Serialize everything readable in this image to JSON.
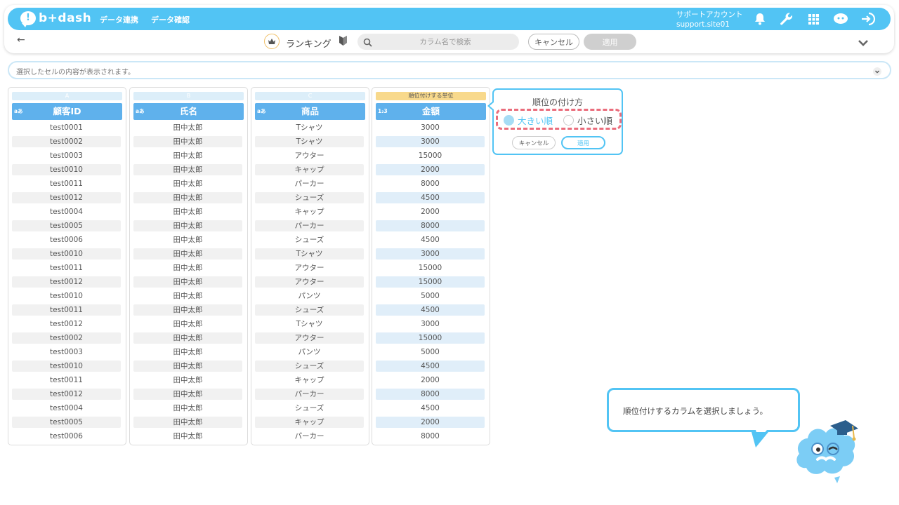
{
  "header": {
    "logo_text": "b+dash",
    "logo_mark": "!",
    "nav": [
      "データ連携",
      "データ確認"
    ],
    "account_name": "サポートアカウント",
    "account_id": "support.site01",
    "icons": [
      "bell-icon",
      "wrench-icon",
      "grid-icon",
      "chat-icon",
      "logout-icon"
    ]
  },
  "toolbar": {
    "title": "ランキング",
    "search_placeholder": "カラム名で検索",
    "cancel_label": "キャンセル",
    "apply_label": "適用"
  },
  "cell_bar": {
    "placeholder": "選択したセルの内容が表示されます。"
  },
  "columns": [
    {
      "letter": "A",
      "header": "顧客ID",
      "type": "aあ",
      "rows": [
        "test0001",
        "test0002",
        "test0003",
        "test0010",
        "test0011",
        "test0012",
        "test0004",
        "test0005",
        "test0006",
        "test0010",
        "test0011",
        "test0012",
        "test0010",
        "test0011",
        "test0012",
        "test0002",
        "test0003",
        "test0010",
        "test0011",
        "test0012",
        "test0004",
        "test0005",
        "test0006"
      ]
    },
    {
      "letter": "B",
      "header": "氏名",
      "type": "aあ",
      "rows": [
        "田中太郎",
        "田中太郎",
        "田中太郎",
        "田中太郎",
        "田中太郎",
        "田中太郎",
        "田中太郎",
        "田中太郎",
        "田中太郎",
        "田中太郎",
        "田中太郎",
        "田中太郎",
        "田中太郎",
        "田中太郎",
        "田中太郎",
        "田中太郎",
        "田中太郎",
        "田中太郎",
        "田中太郎",
        "田中太郎",
        "田中太郎",
        "田中太郎",
        "田中太郎"
      ]
    },
    {
      "letter": "C",
      "header": "商品",
      "type": "aあ",
      "rows": [
        "Tシャツ",
        "Tシャツ",
        "アウター",
        "キャップ",
        "パーカー",
        "シューズ",
        "キャップ",
        "パーカー",
        "シューズ",
        "Tシャツ",
        "アウター",
        "アウター",
        "パンツ",
        "シューズ",
        "Tシャツ",
        "アウター",
        "パンツ",
        "シューズ",
        "キャップ",
        "パーカー",
        "シューズ",
        "キャップ",
        "パーカー"
      ]
    },
    {
      "letter": "順位付けする単位",
      "header": "金額",
      "type": "1₂3",
      "rows": [
        "3000",
        "3000",
        "15000",
        "2000",
        "8000",
        "4500",
        "2000",
        "8000",
        "4500",
        "3000",
        "15000",
        "15000",
        "5000",
        "4500",
        "3000",
        "15000",
        "5000",
        "4500",
        "2000",
        "8000",
        "4500",
        "2000",
        "8000"
      ]
    }
  ],
  "popup": {
    "title": "順位の付け方",
    "option_desc": "大きい順",
    "option_asc": "小さい順",
    "selected": "大きい順",
    "cancel_label": "キャンセル",
    "apply_label": "適用"
  },
  "guide": {
    "message": "順位付けするカラムを選択しましょう。"
  },
  "colors": {
    "brand": "#52c4f4",
    "header_blue": "#5fb1ec",
    "rank_unit": "#f8d98c",
    "highlight": "#ea6d7c"
  }
}
